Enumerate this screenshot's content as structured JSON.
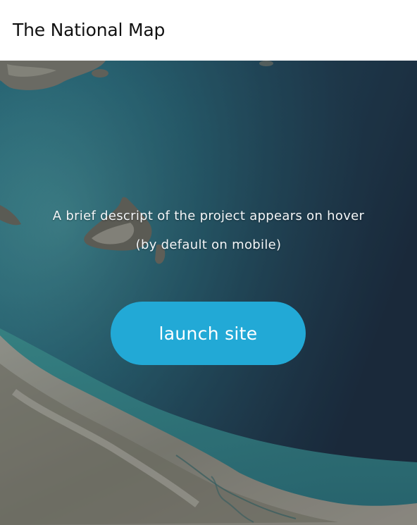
{
  "header": {
    "title": "The National Map"
  },
  "hero": {
    "description_line1": "A brief descript of the project appears on hover",
    "description_line2": "(by default on mobile)",
    "launch_label": "launch site"
  },
  "colors": {
    "header_bg": "#ffffff",
    "title_text": "#111111",
    "button_bg": "#22a9d6",
    "button_text": "#ffffff",
    "ocean_deep": "#1f3347",
    "ocean_shallow": "#3d8f95",
    "land": "#9a9a8c"
  }
}
